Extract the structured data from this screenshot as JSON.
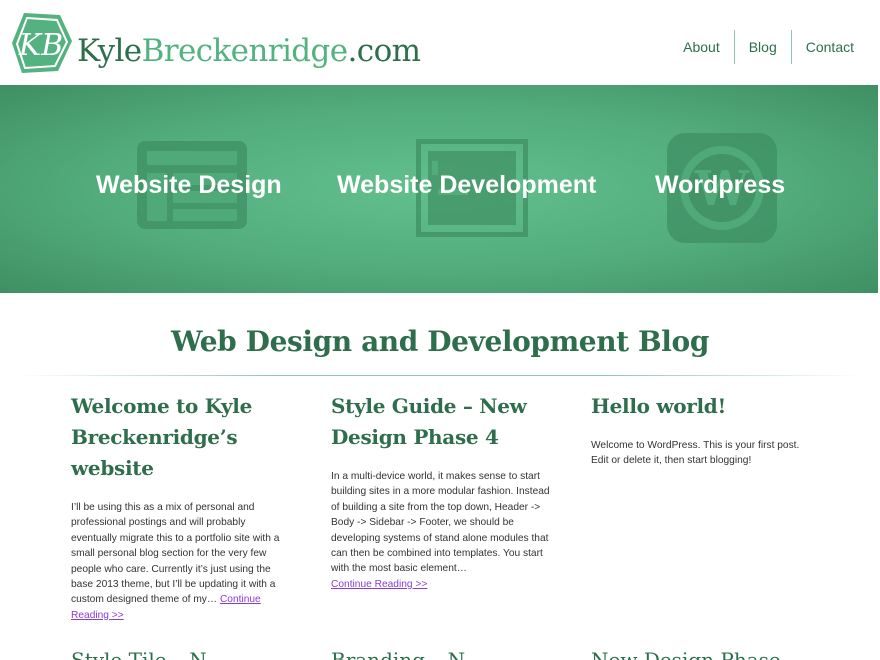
{
  "header": {
    "site_name_part1": "Kyle",
    "site_name_part2": "Breckenridge",
    "site_name_part3": ".com",
    "logo_letters": "KB",
    "nav": [
      "About",
      "Blog",
      "Contact"
    ]
  },
  "hero": {
    "items": [
      {
        "label": "Website Design",
        "icon": "layout-icon"
      },
      {
        "label": "Website Development",
        "icon": "terminal-icon"
      },
      {
        "label": "Wordpress",
        "icon": "wordpress-icon"
      }
    ]
  },
  "blog": {
    "heading": "Web Design and Development Blog",
    "posts": [
      {
        "title": "Welcome to Kyle Breckenridge’s website",
        "excerpt": "I’ll be using this as a mix of personal and professional postings and will probably eventually migrate this to a portfolio site with a small personal blog section for the very few people who care. Currently it’s just using the base 2013 theme, but I’ll be updating it with a custom designed theme of my…",
        "more": "Continue Reading >>"
      },
      {
        "title": "Style Guide – New Design Phase 4",
        "excerpt": "In a multi-device world, it makes sense to start building sites in a more modular fashion. Instead of building a site from the top down, Header -> Body -> Sidebar -> Footer, we should be developing systems of stand alone modules that can then be combined into templates. You start with the most basic element…",
        "more": "Continue Reading >>"
      },
      {
        "title": "Hello world!",
        "excerpt": "Welcome to WordPress. This is your first post. Edit or delete it, then start blogging!",
        "more": ""
      }
    ],
    "next_row_titles": [
      "Style Tile – N",
      "Branding – N",
      "New Design Phase"
    ]
  },
  "colors": {
    "brand_dark": "#2e6e4c",
    "brand_light": "#53b27f",
    "link": "#8a3bd6"
  }
}
